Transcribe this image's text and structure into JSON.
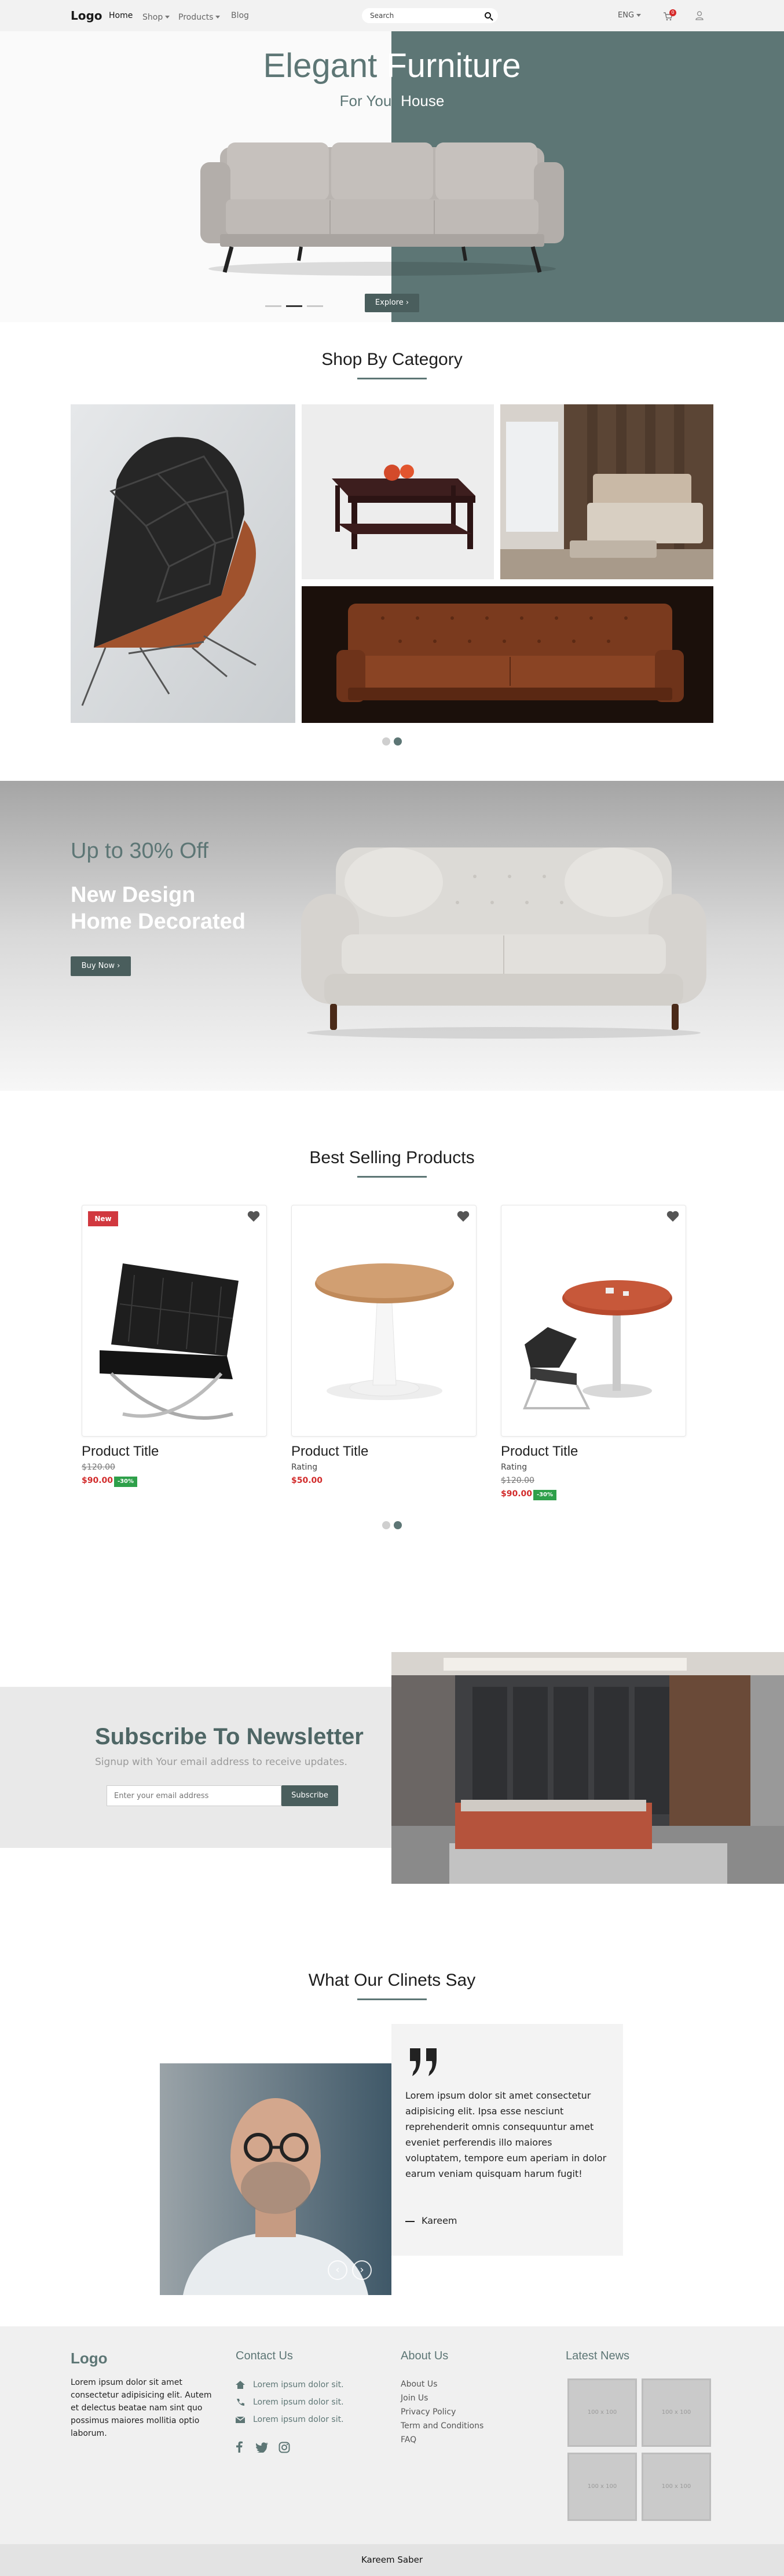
{
  "navbar": {
    "logo": "Logo",
    "links": [
      "Home",
      "Shop",
      "Products",
      "Blog"
    ],
    "search_placeholder": "Search",
    "language": "ENG",
    "cart_count": "0"
  },
  "hero": {
    "title_part1": "Elegant ",
    "title_part2": "Furniture",
    "subtitle_part1": "For Your ",
    "subtitle_part2": "House",
    "button": "Explore"
  },
  "categories": {
    "title": "Shop By Category"
  },
  "promo": {
    "discount": "Up to 30% Off",
    "line1": "New Design",
    "line2": "Home Decorated",
    "button": "Buy Now"
  },
  "best_selling": {
    "title": "Best Selling Products",
    "products": [
      {
        "badge": "New",
        "title": "Product Title",
        "old_price": "$120.00",
        "price": "$90.00",
        "discount": "-30%"
      },
      {
        "title": "Product Title",
        "rating": "Rating",
        "price": "$50.00"
      },
      {
        "title": "Product Title",
        "rating": "Rating",
        "old_price": "$120.00",
        "price": "$90.00",
        "discount": "-30%"
      }
    ]
  },
  "newsletter": {
    "title": "Subscribe To Newsletter",
    "subtitle": "Signup with Your email address to receive updates.",
    "placeholder": "Enter your email address",
    "button": "Subscribe"
  },
  "testimonials": {
    "title": "What Our Clinets Say",
    "quote": "Lorem ipsum dolor sit amet consectetur adipisicing elit. Ipsa esse nesciunt reprehenderit omnis consequuntur amet eveniet perferendis illo maiores voluptatem, tempore eum aperiam in dolor earum veniam quisquam harum fugit!",
    "author": "Kareem"
  },
  "footer": {
    "logo": "Logo",
    "about_text": "Lorem ipsum dolor sit amet consectetur adipisicing elit. Autem et delectus beatae nam sint quo possimus maiores mollitia optio laborum.",
    "contact_title": "Contact Us",
    "contact_lines": [
      "Lorem ipsum dolor sit.",
      "Lorem ipsum dolor sit.",
      "Lorem ipsum dolor sit."
    ],
    "about_title": "About Us",
    "about_links": [
      "About Us",
      "Join Us",
      "Privacy Policy",
      "Term and Conditions",
      "FAQ"
    ],
    "news_title": "Latest News",
    "thumb_label": "100 x 100",
    "copyright": "Kareem Saber"
  },
  "colors": {
    "accent": "#5d7675",
    "sale": "#d22c2c",
    "discount": "#2ea04a",
    "badge": "#d1383f"
  }
}
